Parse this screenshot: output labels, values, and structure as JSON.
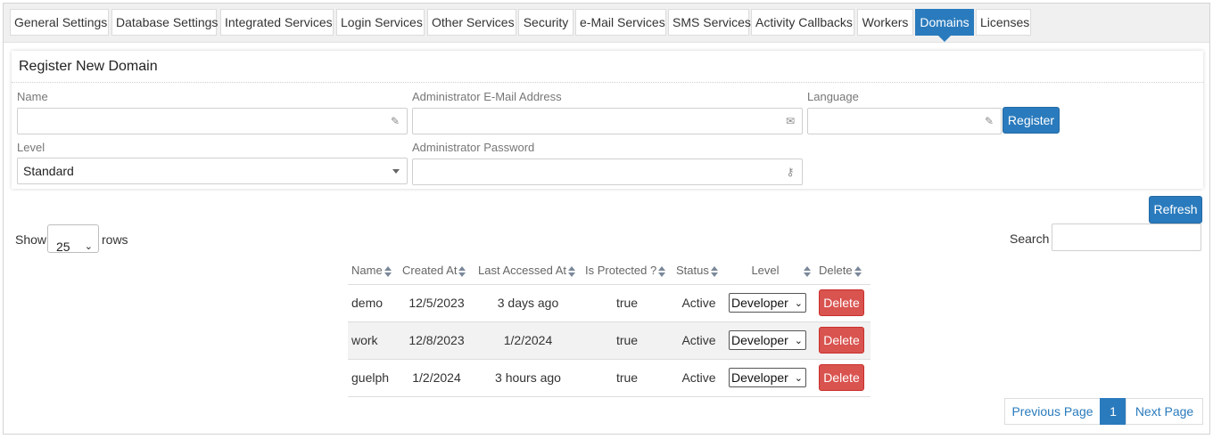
{
  "tabs": [
    {
      "label": "General Settings",
      "active": false
    },
    {
      "label": "Database Settings",
      "active": false
    },
    {
      "label": "Integrated Services",
      "active": false
    },
    {
      "label": "Login Services",
      "active": false
    },
    {
      "label": "Other Services",
      "active": false
    },
    {
      "label": "Security",
      "active": false
    },
    {
      "label": "e-Mail Services",
      "active": false
    },
    {
      "label": "SMS Services",
      "active": false
    },
    {
      "label": "Activity Callbacks",
      "active": false
    },
    {
      "label": "Workers",
      "active": false
    },
    {
      "label": "Domains",
      "active": true
    },
    {
      "label": "Licenses",
      "active": false
    }
  ],
  "register": {
    "title": "Register New Domain",
    "name_label": "Name",
    "name_value": "",
    "email_label": "Administrator E-Mail Address",
    "email_value": "",
    "language_label": "Language",
    "language_value": "",
    "level_label": "Level",
    "level_value": "Standard",
    "password_label": "Administrator Password",
    "password_value": "",
    "register_button": "Register"
  },
  "toolbar": {
    "refresh_button": "Refresh",
    "show_label": "Show",
    "rows_value": "25",
    "rows_label": "rows",
    "search_label": "Search",
    "search_value": ""
  },
  "table": {
    "columns": [
      "Name",
      "Created At",
      "Last Accessed At",
      "Is Protected ?",
      "Status",
      "Level",
      "Delete"
    ],
    "rows": [
      {
        "name": "demo",
        "created": "12/5/2023",
        "accessed": "3 days ago",
        "protected": "true",
        "status": "Active",
        "level": "Developer",
        "delete": "Delete"
      },
      {
        "name": "work",
        "created": "12/8/2023",
        "accessed": "1/2/2024",
        "protected": "true",
        "status": "Active",
        "level": "Developer",
        "delete": "Delete"
      },
      {
        "name": "guelph",
        "created": "1/2/2024",
        "accessed": "3 hours ago",
        "protected": "true",
        "status": "Active",
        "level": "Developer",
        "delete": "Delete"
      }
    ]
  },
  "pagination": {
    "previous": "Previous Page",
    "current": "1",
    "next": "Next Page"
  },
  "colors": {
    "accent": "#2a7bbd",
    "danger": "#d9534f"
  },
  "icons": {
    "name_field": "pencil-icon",
    "email_field": "envelope-icon",
    "language_field": "pencil-icon",
    "password_field": "key-icon"
  }
}
